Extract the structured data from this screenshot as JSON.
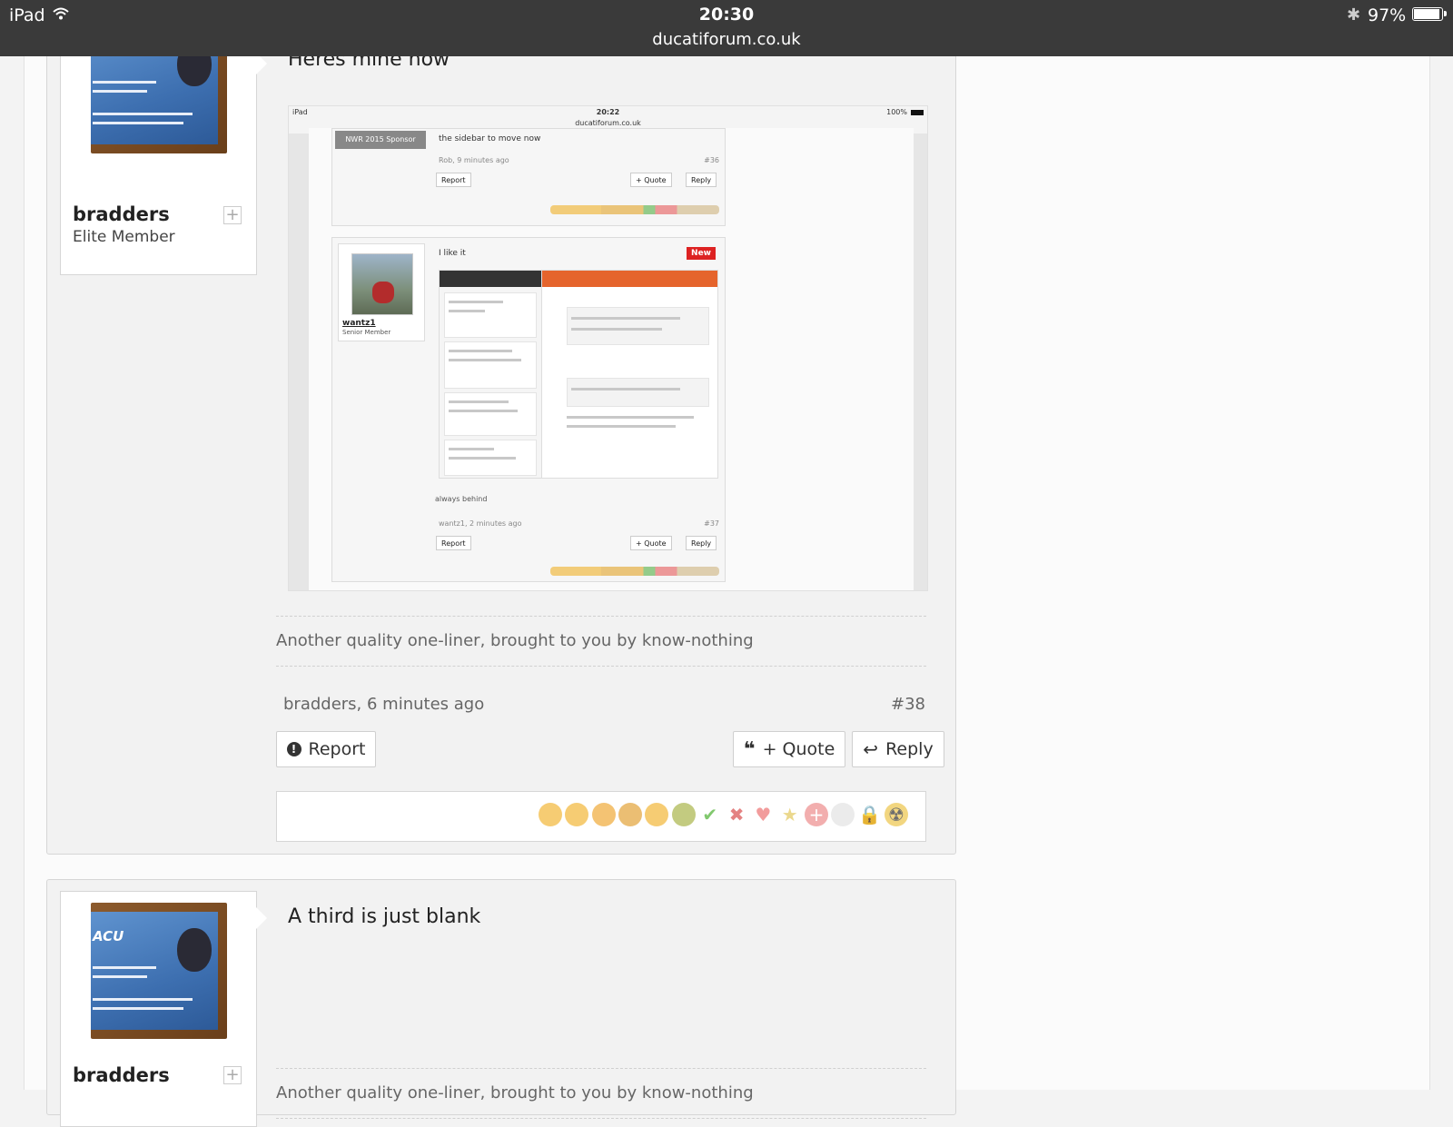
{
  "status_bar": {
    "device": "iPad",
    "time": "20:30",
    "url": "ducatiforum.co.uk",
    "battery": "97%",
    "battery_level": 0.97
  },
  "post1": {
    "username": "bradders",
    "rank": "Elite Member",
    "message": "Heres mine now",
    "signature": "Another quality one-liner, brought to you by know-nothing",
    "meta": "bradders, 6 minutes ago",
    "post_number": "#38",
    "report_label": "Report",
    "quote_label": "+ Quote",
    "reply_label": "Reply",
    "embedded_screenshot": {
      "device": "iPad",
      "time": "20:22",
      "url": "ducatiforum.co.uk",
      "battery": "100%",
      "prev_sponsor": "NWR 2015 Sponsor",
      "prev_text": "the sidebar to move now",
      "prev_meta": "Rob, 9 minutes ago",
      "prev_num": "#36",
      "report": "Report",
      "quote": "+ Quote",
      "reply": "Reply",
      "nested_user": "wantz1",
      "nested_rank": "Senior Member",
      "nested_text": "I like it",
      "nested_badge": "New",
      "nested_sig": "always behind",
      "nested_meta": "wantz1, 2 minutes ago",
      "nested_num": "#37"
    }
  },
  "post2": {
    "username": "bradders",
    "message": "A third is just blank",
    "signature": "Another quality one-liner, brought to you by know-nothing"
  },
  "reactions": [
    "laughing-icon",
    "winking-icon",
    "surprised-icon",
    "drinking-icon",
    "grinning-icon",
    "sick-icon",
    "check-icon",
    "cross-icon",
    "heart-icon",
    "star-icon",
    "first-aid-icon",
    "toilet-roll-icon",
    "lock-icon",
    "radioactive-icon"
  ],
  "colors": {
    "status_bar": "#3a3a3a",
    "new_badge": "#dd2222",
    "app_header": "#e5642c"
  }
}
